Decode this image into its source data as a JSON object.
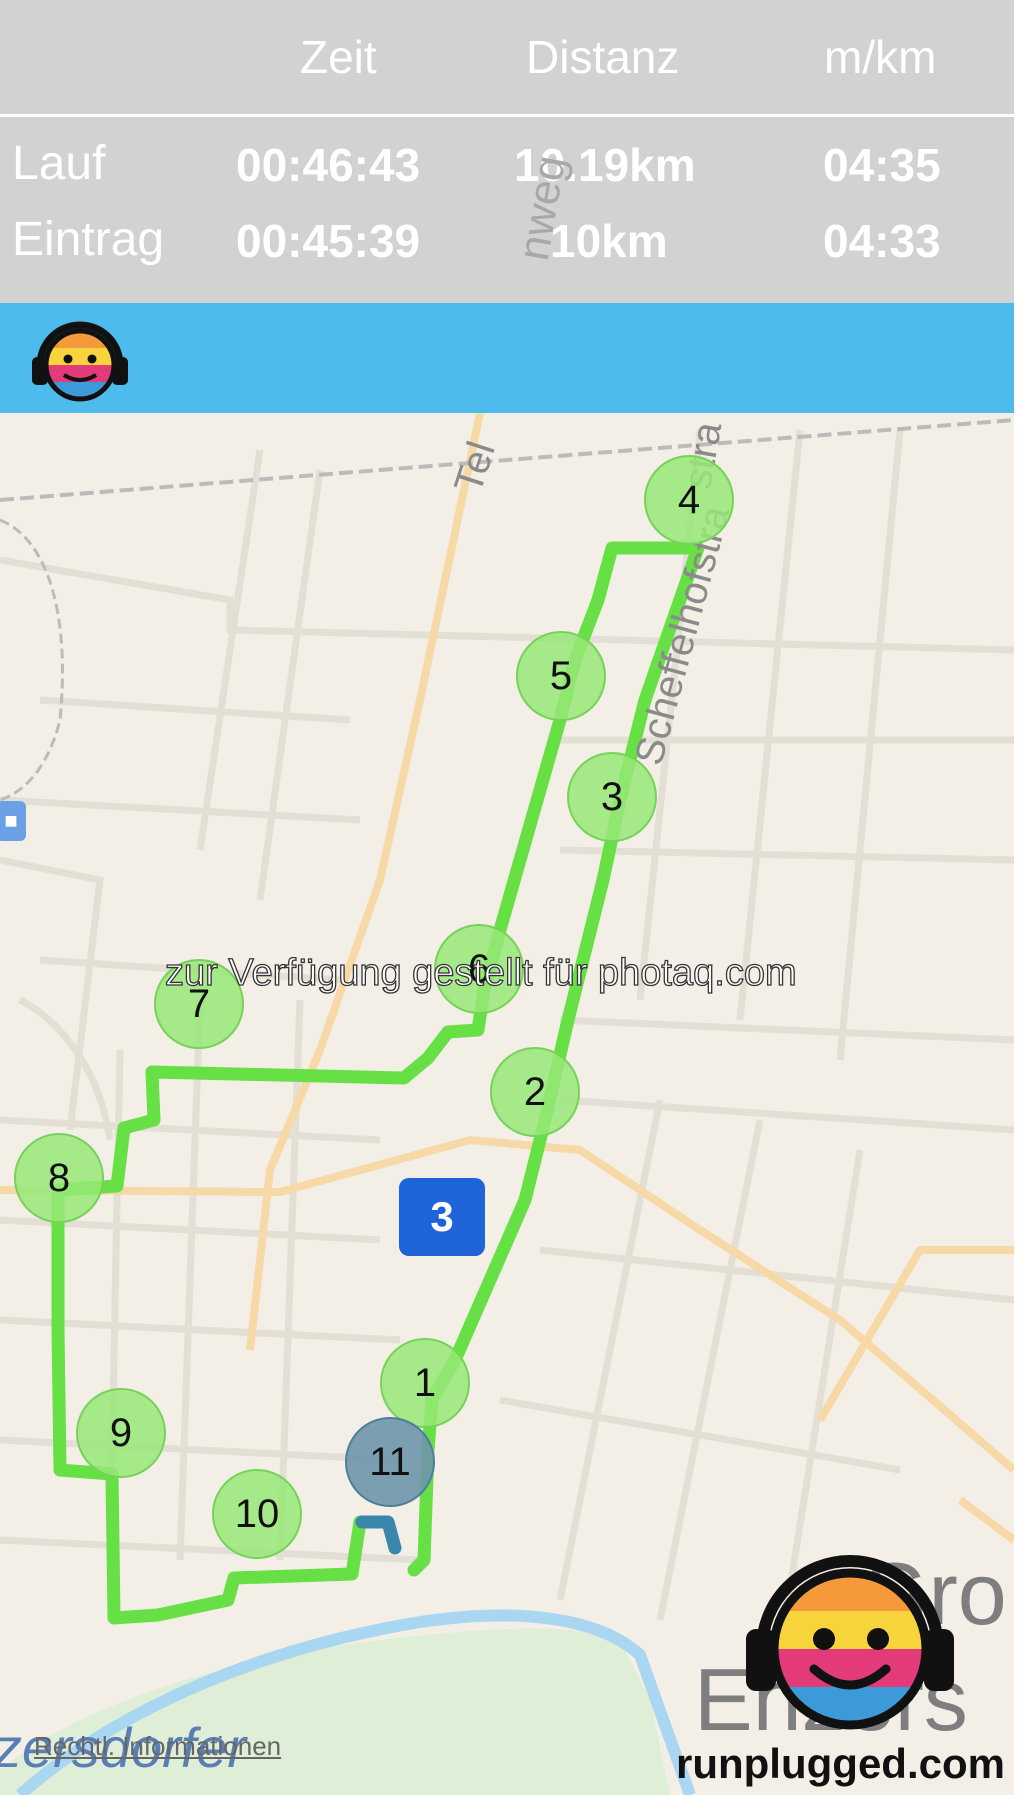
{
  "header": {
    "col_time": "Zeit",
    "col_distance": "Distanz",
    "col_pace": "m/km"
  },
  "rows": [
    {
      "label": "Lauf",
      "time": "00:46:43",
      "distance": "10.19km",
      "pace": "04:35"
    },
    {
      "label": "Eintrag",
      "time": "00:45:39",
      "distance": "10km",
      "pace": "04:33"
    }
  ],
  "icons": {
    "topbar_logo": "headphones-smiley-icon",
    "brand_logo": "headphones-smiley-icon",
    "transit": "bus-icon"
  },
  "colors": {
    "stats_bg": "#d2d2d2",
    "bluebar": "#4dbbeb",
    "route": "#66e045",
    "marker": "#96e878",
    "current_marker": "#6e96aa",
    "route_badge": "#1f63d8"
  },
  "map": {
    "markers": [
      "1",
      "2",
      "3",
      "4",
      "5",
      "6",
      "7",
      "8",
      "9",
      "10",
      "11"
    ],
    "route_badge": "3",
    "street_fragments": [
      "Tel",
      "stra",
      "Scheffelhofstra",
      "nweg",
      "Gro",
      "Enzers",
      "zersdorfer"
    ],
    "watermark": "zur Verfügung gestellt für photaq.com",
    "legal_link": "Rechtl. Informationen"
  },
  "brand_text": "runplugged.com"
}
